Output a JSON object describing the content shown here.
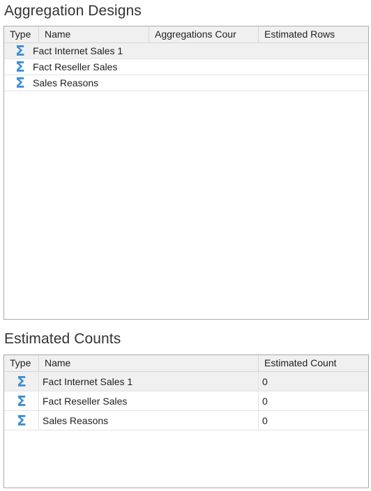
{
  "aggregation_designs": {
    "title": "Aggregation Designs",
    "columns": [
      "Type",
      "Name",
      "Aggregations Cour",
      "Estimated Rows"
    ],
    "rows": [
      {
        "icon": "sigma-icon",
        "name": "Fact Internet Sales 1",
        "aggregations_count": "",
        "estimated_rows": ""
      },
      {
        "icon": "sigma-icon",
        "name": "Fact Reseller Sales",
        "aggregations_count": "",
        "estimated_rows": ""
      },
      {
        "icon": "sigma-icon",
        "name": "Sales Reasons",
        "aggregations_count": "",
        "estimated_rows": ""
      }
    ]
  },
  "estimated_counts": {
    "title": "Estimated Counts",
    "columns": [
      "Type",
      "Name",
      "Estimated Count"
    ],
    "rows": [
      {
        "icon": "sigma-icon",
        "name": "Fact Internet Sales 1",
        "estimated_count": "0"
      },
      {
        "icon": "sigma-icon",
        "name": "Fact Reseller Sales",
        "estimated_count": "0"
      },
      {
        "icon": "sigma-icon",
        "name": "Sales Reasons",
        "estimated_count": "0"
      }
    ]
  },
  "icon_glyph": "Σ",
  "colors": {
    "icon": "#3b8fd6",
    "selected_row": "#f0f0f0",
    "header": "#f0f0f0"
  }
}
